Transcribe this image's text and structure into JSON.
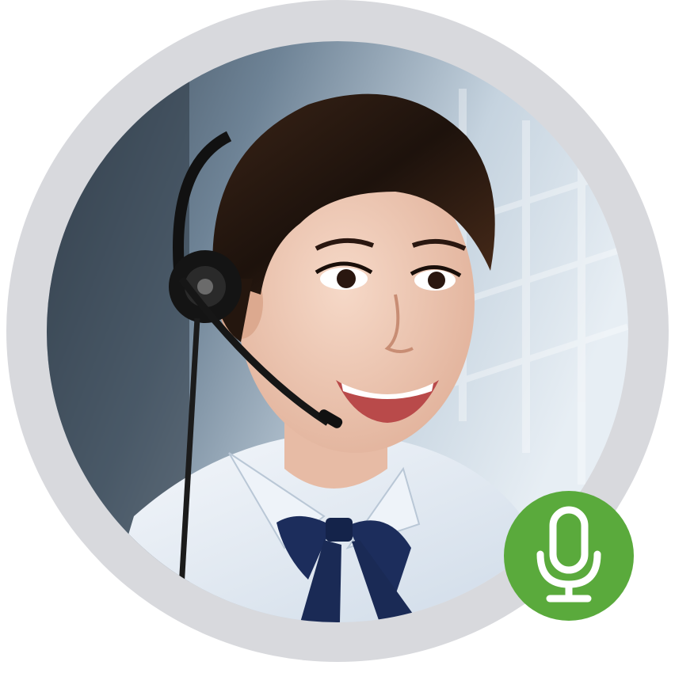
{
  "avatar": {
    "kind": "support-agent-photo",
    "alt": "",
    "frame_color": "#d8d9dd",
    "subject": {
      "hair_color": "#2a1a12",
      "shirt_color": "#e6eef8",
      "bow_color": "#1c2d5c",
      "headset_color": "#111111"
    }
  },
  "mic_badge": {
    "icon": "microphone-icon",
    "background_color": "#5aaa3c",
    "icon_color": "#ffffff"
  }
}
